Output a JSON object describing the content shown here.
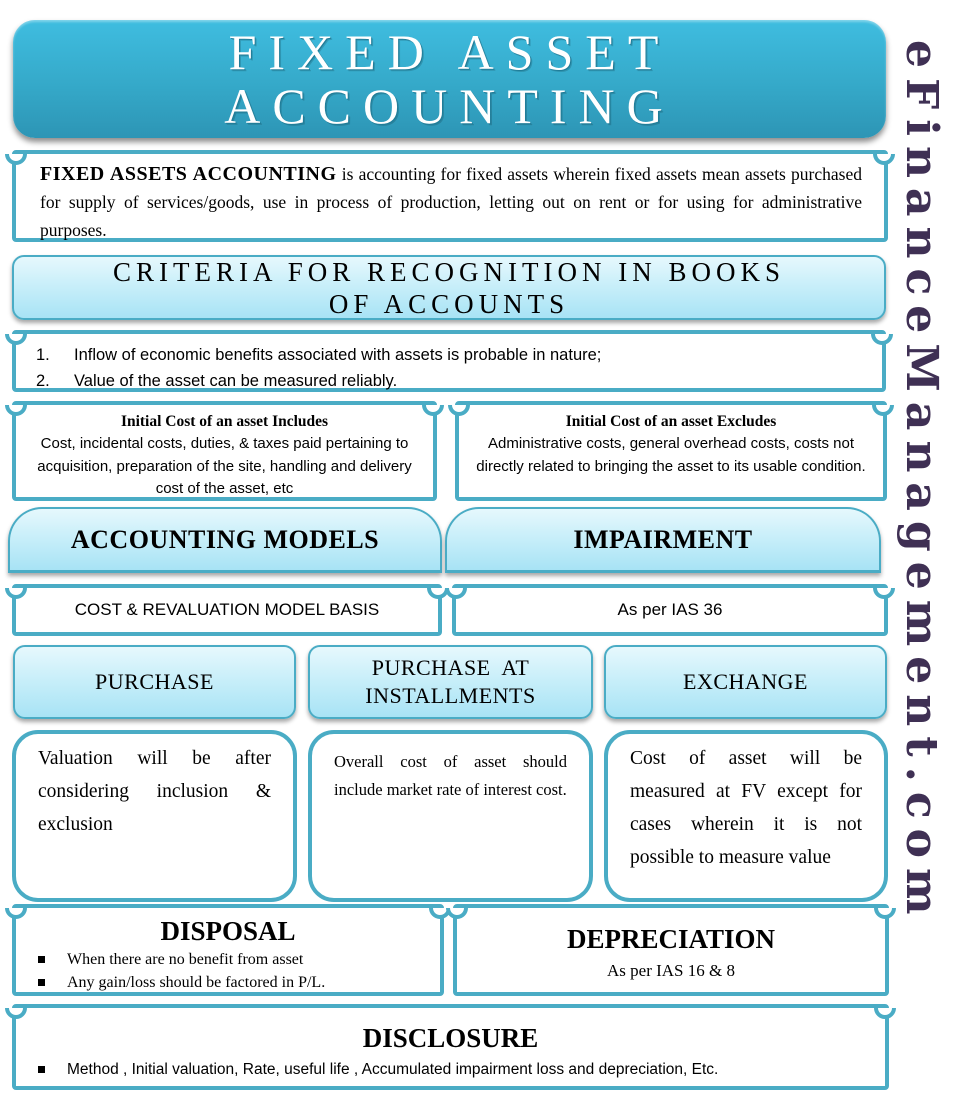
{
  "title": {
    "line1": "FIXED ASSET",
    "line2": "ACCOUNTING"
  },
  "definition": {
    "term": "FIXED ASSETS ACCOUNTING",
    "text": " is accounting for fixed assets wherein fixed assets mean assets purchased for supply of services/goods, use in process of production, letting out on rent or for using for administrative purposes."
  },
  "criteria": {
    "header_line1": "CRITERIA FOR RECOGNITION IN BOOKS",
    "header_line2": "OF ACCOUNTS",
    "items": [
      {
        "num": "1.",
        "text": "Inflow of economic benefits associated with assets is probable in nature;"
      },
      {
        "num": "2.",
        "text": "Value of the asset can be measured reliably."
      }
    ]
  },
  "initial_cost": {
    "includes": {
      "heading": "Initial Cost of an asset Includes",
      "body": "Cost, incidental costs, duties, & taxes paid pertaining to acquisition, preparation of the site, handling and delivery cost of the asset, etc"
    },
    "excludes": {
      "heading": "Initial Cost of an asset Excludes",
      "body": "Administrative costs, general overhead costs, costs not directly related to bringing the asset to its usable condition."
    }
  },
  "accounting_models": {
    "heading": "ACCOUNTING MODELS",
    "value": "COST & REVALUATION MODEL BASIS"
  },
  "impairment": {
    "heading": "IMPAIRMENT",
    "value": "As per IAS 36"
  },
  "acquisition_methods": [
    {
      "heading_line1": "PURCHASE",
      "heading_line2": "",
      "body": "Valuation will be after considering inclusion & exclusion"
    },
    {
      "heading_line1": "PURCHASE  AT",
      "heading_line2": "INSTALLMENTS",
      "body": "Overall cost of asset should include market rate of interest cost."
    },
    {
      "heading_line1": "EXCHANGE",
      "heading_line2": "",
      "body": "Cost of asset will be measured at FV except for cases wherein it is not possible to measure value"
    }
  ],
  "disposal": {
    "heading": "DISPOSAL",
    "bullets": [
      "When there are no benefit from asset",
      "Any gain/loss should be factored in P/L."
    ]
  },
  "depreciation": {
    "heading": "DEPRECIATION",
    "value": "As per IAS 16 & 8"
  },
  "disclosure": {
    "heading": "DISCLOSURE",
    "bullets": [
      "Method , Initial valuation, Rate, useful life , Accumulated impairment loss and depreciation, Etc."
    ]
  },
  "watermark": "eFinanceManagement.com",
  "colors": {
    "title_blue": "#3ab4d6",
    "border_teal": "#4aacc5",
    "aqua_light": "#c6eef9",
    "watermark_purple": "#3f3054"
  }
}
